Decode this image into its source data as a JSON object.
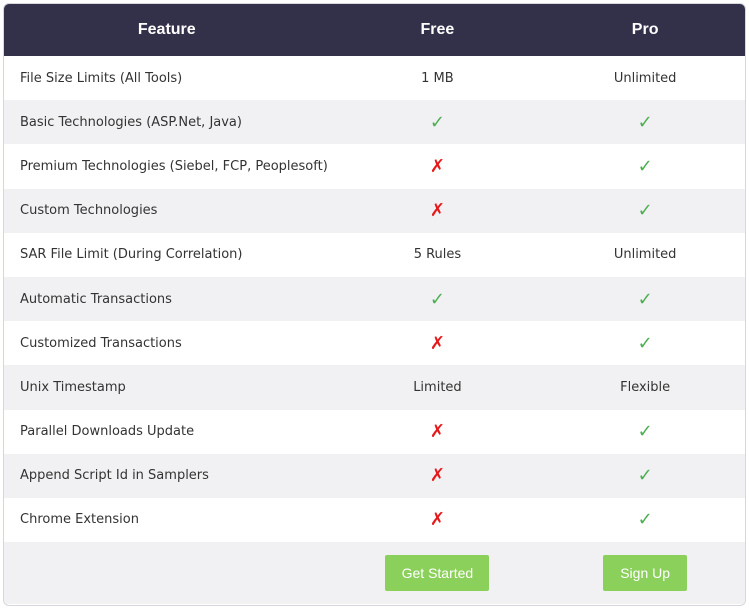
{
  "header": {
    "feature": "Feature",
    "free": "Free",
    "pro": "Pro"
  },
  "rows": [
    {
      "feature": "File Size Limits (All Tools)",
      "free": "1 MB",
      "pro": "Unlimited"
    },
    {
      "feature": "Basic Technologies (ASP.Net, Java)",
      "free": "✓",
      "pro": "✓"
    },
    {
      "feature": "Premium Technologies (Siebel, FCP, Peoplesoft)",
      "free": "✗",
      "pro": "✓"
    },
    {
      "feature": "Custom Technologies",
      "free": "✗",
      "pro": "✓"
    },
    {
      "feature": "SAR File Limit (During Correlation)",
      "free": "5 Rules",
      "pro": "Unlimited"
    },
    {
      "feature": "Automatic Transactions",
      "free": "✓",
      "pro": "✓"
    },
    {
      "feature": "Customized Transactions",
      "free": "✗",
      "pro": "✓"
    },
    {
      "feature": "Unix Timestamp",
      "free": "Limited",
      "pro": "Flexible"
    },
    {
      "feature": "Parallel Downloads Update",
      "free": "✗",
      "pro": "✓"
    },
    {
      "feature": "Append Script Id in Samplers",
      "free": "✗",
      "pro": "✓"
    },
    {
      "feature": "Chrome Extension",
      "free": "✗",
      "pro": "✓"
    }
  ],
  "buttons": {
    "free": "Get Started",
    "pro": "Sign Up"
  },
  "colors": {
    "header_bg": "#33304a",
    "check": "#4caf50",
    "cross": "#e5191b",
    "button": "#8bd05a"
  }
}
